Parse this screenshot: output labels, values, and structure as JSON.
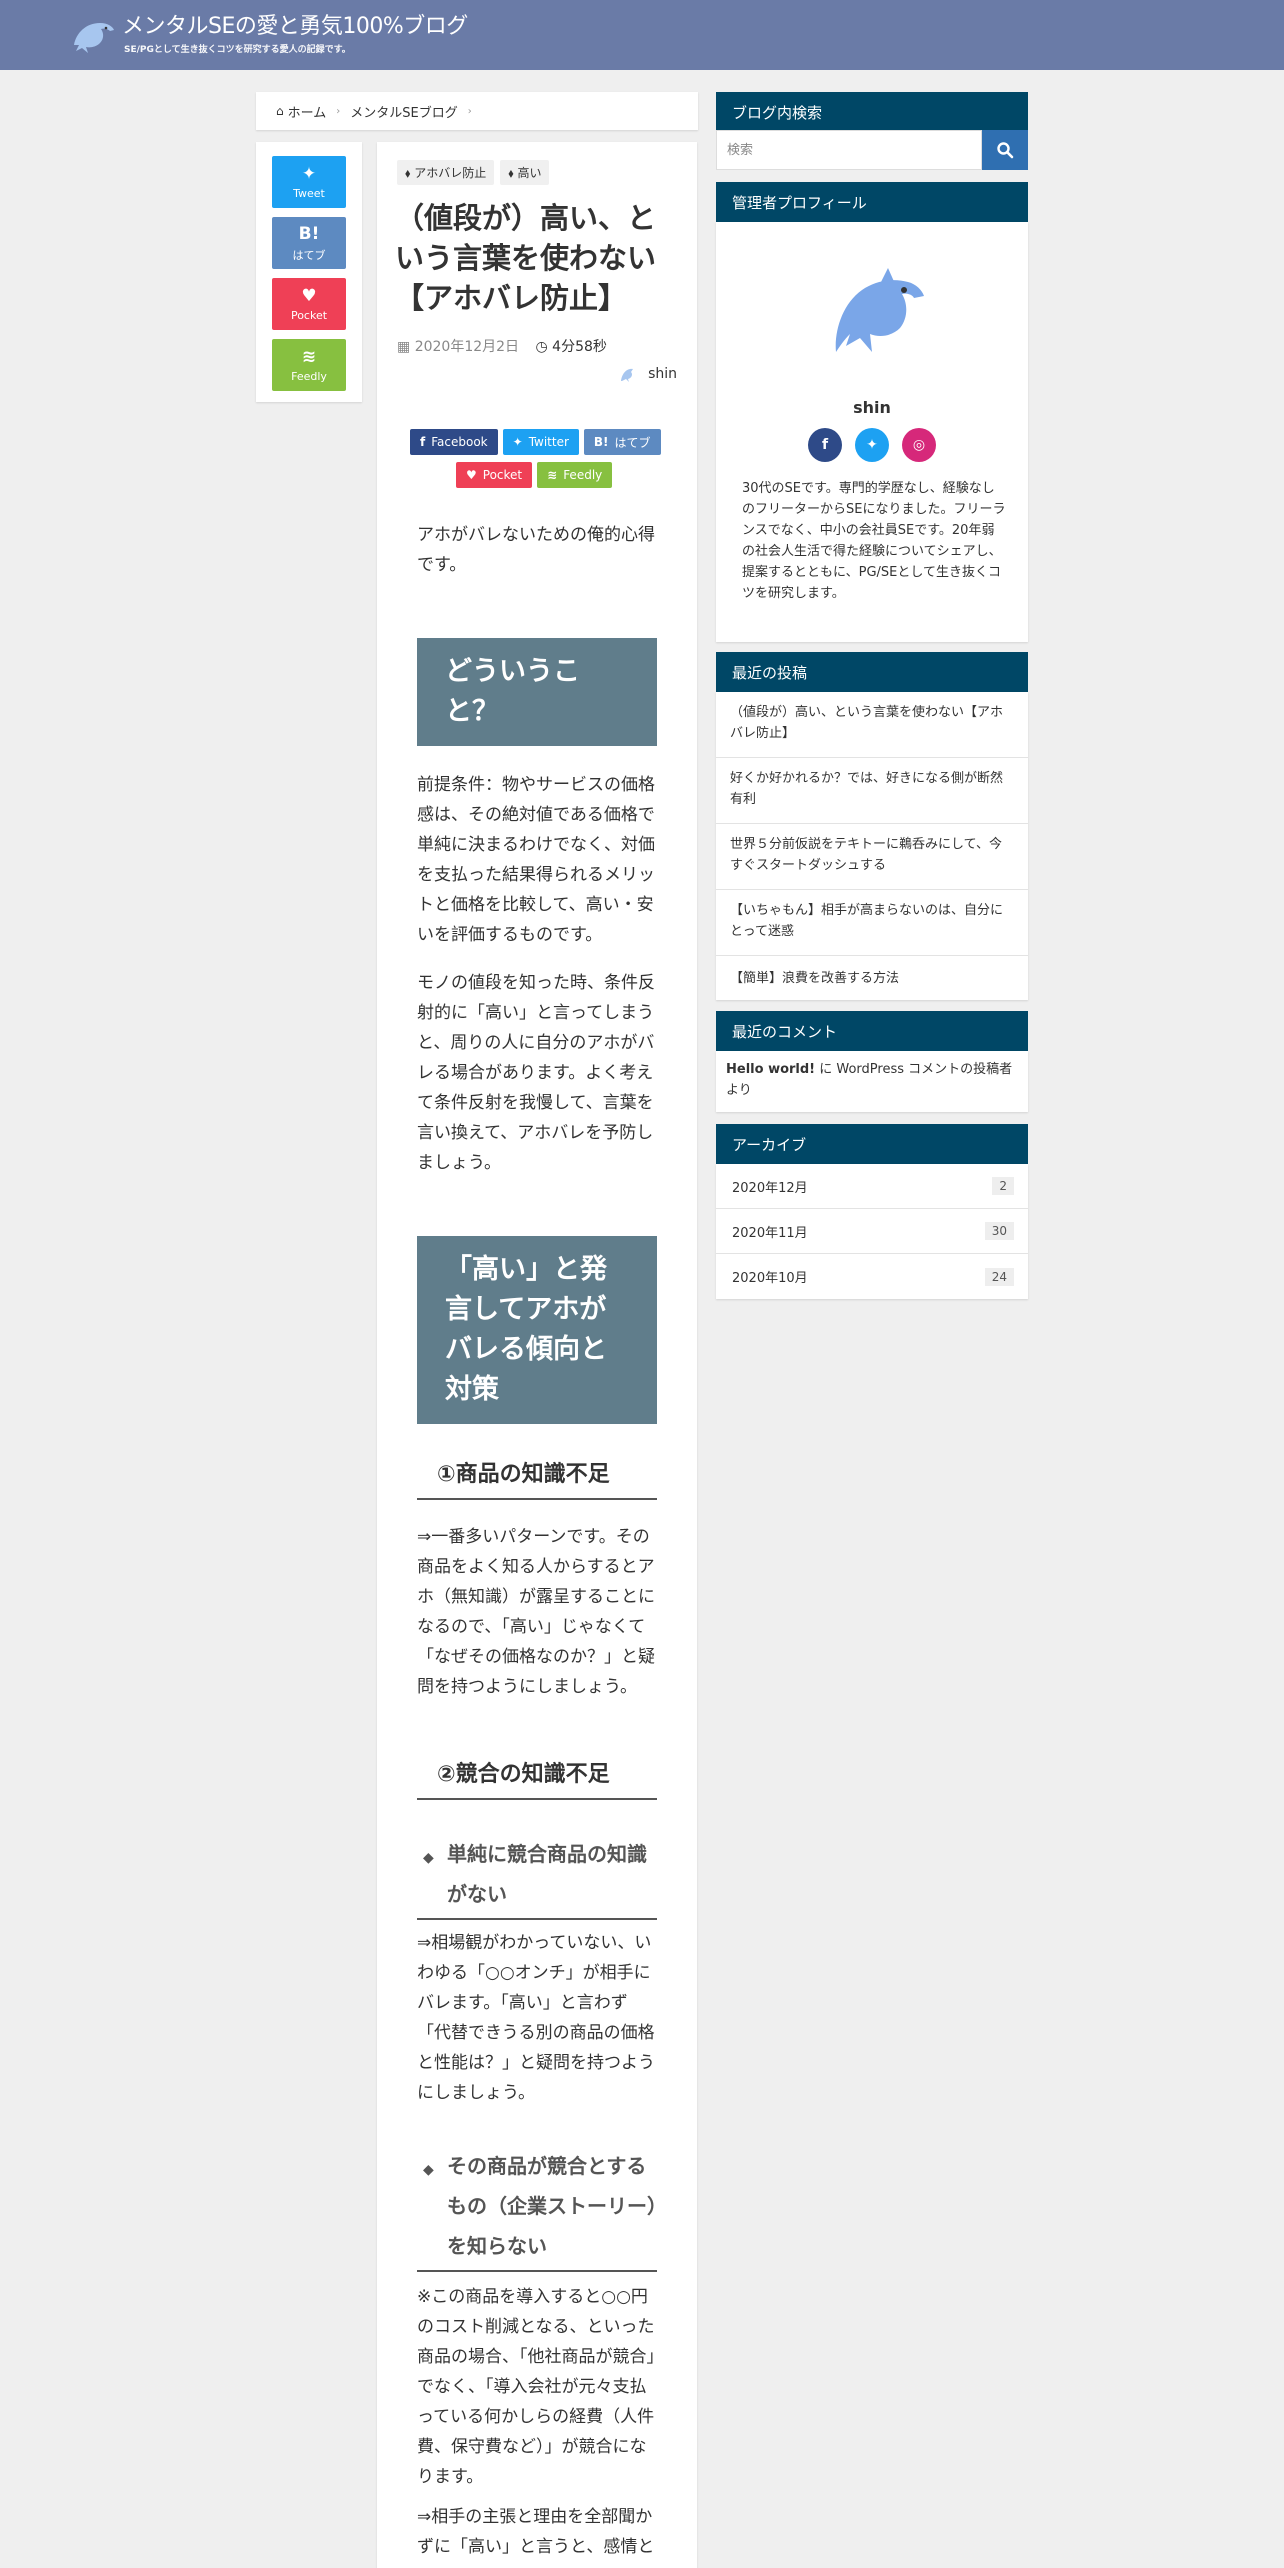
{
  "header": {
    "title": "メンタルSEの愛と勇気100%ブログ",
    "subtitle": "SE/PGとして生き抜くコツを研究する愛人の記録です。",
    "brand_color": "#6a7ba7"
  },
  "breadcrumb": {
    "home": "ホーム",
    "category": "メンタルSEブログ"
  },
  "share_sidebar": [
    {
      "name": "tweet",
      "icon": "twitter-icon",
      "label": "Tweet",
      "color": "#1da1f2"
    },
    {
      "name": "hatebu",
      "icon": "hatena-icon",
      "glyph": "B!",
      "label": "はてブ",
      "color": "#5d8ac1"
    },
    {
      "name": "pocket",
      "icon": "pocket-icon",
      "label": "Pocket",
      "color": "#ef4056"
    },
    {
      "name": "feedly",
      "icon": "feedly-icon",
      "label": "Feedly",
      "color": "#87c040"
    }
  ],
  "article": {
    "tags": [
      "アホバレ防止",
      "高い"
    ],
    "title_lines": [
      "（値段が）高い、と",
      "いう言葉を使わない",
      "【アホバレ防止】"
    ],
    "date": "2020年12月2日",
    "read_time": "4分58秒",
    "author": "shin",
    "share_row1": [
      {
        "name": "facebook",
        "glyph": "f",
        "label": "Facebook",
        "color": "#2e4a88"
      },
      {
        "name": "twitter",
        "glyph": "✦",
        "label": "Twitter",
        "color": "#1da1f2"
      },
      {
        "name": "hatebu",
        "glyph": "B!",
        "label": "はてブ",
        "color": "#5d8ac1"
      }
    ],
    "share_row2": [
      {
        "name": "pocket",
        "glyph": "♥",
        "label": "Pocket",
        "color": "#ef4056"
      },
      {
        "name": "feedly",
        "glyph": "≋",
        "label": "Feedly",
        "color": "#87c040"
      }
    ],
    "intro": "アホがバレないための俺的心得です。",
    "h2_1": "どういうこと？",
    "p1": "前提条件：物やサービスの価格感は、その絶対値である価格で単純に決まるわけでなく、対価を支払った結果得られるメリットと価格を比較して、高い・安いを評価するものです。",
    "p2": "モノの値段を知った時、条件反射的に「高い」と言ってしまうと、周りの人に自分のアホがバレる場合があります。よく考えて条件反射を我慢して、言葉を言い換えて、アホバレを予防しましょう。",
    "h2_2": "「高い」と発言してアホがバレる傾向と対策",
    "h3_1": "①商品の知識不足",
    "p3": "⇒一番多いパターンです。その商品をよく知る人からするとアホ（無知識）が露呈することになるので、「高い」じゃなくて「なぜその価格なのか？」と疑問を持つようにしましょう。",
    "h3_2": "②競合の知識不足",
    "h4_1": "単純に競合商品の知識がない",
    "p4": "⇒相場観がわかっていない、いわゆる「○○オンチ」が相手にバレます。「高い」と言わず「代替できうる別の商品の価格と性能は？」と疑問を持つようにしましょう。",
    "h4_2": "その商品が競合とするもの（企業ストーリー）を知らない",
    "p5": "※この商品を導入すると○○円のコスト削減となる、といった商品の場合、「他社商品が競合」でなく、「導入会社が元々支払っている何かしらの経費（人件費、保守費など）」が競合になります。",
    "p6": "⇒相手の主張と理由を全部聞かずに「高い」と言うと、感情と"
  },
  "sidebar": {
    "search_title": "ブログ内検索",
    "search_placeholder": "検索",
    "profile_title": "管理者プロフィール",
    "profile_name": "shin",
    "profile_desc": "30代のSEです。専門的学歴なし、経験なしのフリーターからSEになりました。フリーランスでなく、中小の会社員SEです。20年弱の社会人生活で得た経験についてシェアし、提案するとともに、PG/SEとして生き抜くコツを研究します。",
    "socials": [
      {
        "name": "facebook",
        "glyph": "f",
        "color": "#2e4a88"
      },
      {
        "name": "twitter",
        "glyph": "✦",
        "color": "#1da1f2"
      },
      {
        "name": "instagram",
        "glyph": "◎",
        "color": "#d6287a"
      }
    ],
    "recent_title": "最近の投稿",
    "recent_posts": [
      "（値段が）高い、という言葉を使わない【アホバレ防止】",
      "好くか好かれるか？では、好きになる側が断然有利",
      "世界５分前仮説をテキトーに鵜呑みにして、今すぐスタートダッシュする",
      "【いちゃもん】相手が高まらないのは、自分にとって迷惑",
      "【簡単】浪費を改善する方法"
    ],
    "comments_title": "最近のコメント",
    "comment_post": "Hello world!",
    "comment_rest": " に WordPress コメントの投稿者 より",
    "archive_title": "アーカイブ",
    "archives": [
      {
        "label": "2020年12月",
        "count": "2"
      },
      {
        "label": "2020年11月",
        "count": "30"
      },
      {
        "label": "2020年10月",
        "count": "24"
      }
    ],
    "widget_color": "#004766",
    "accent": "#2f6fb1"
  }
}
